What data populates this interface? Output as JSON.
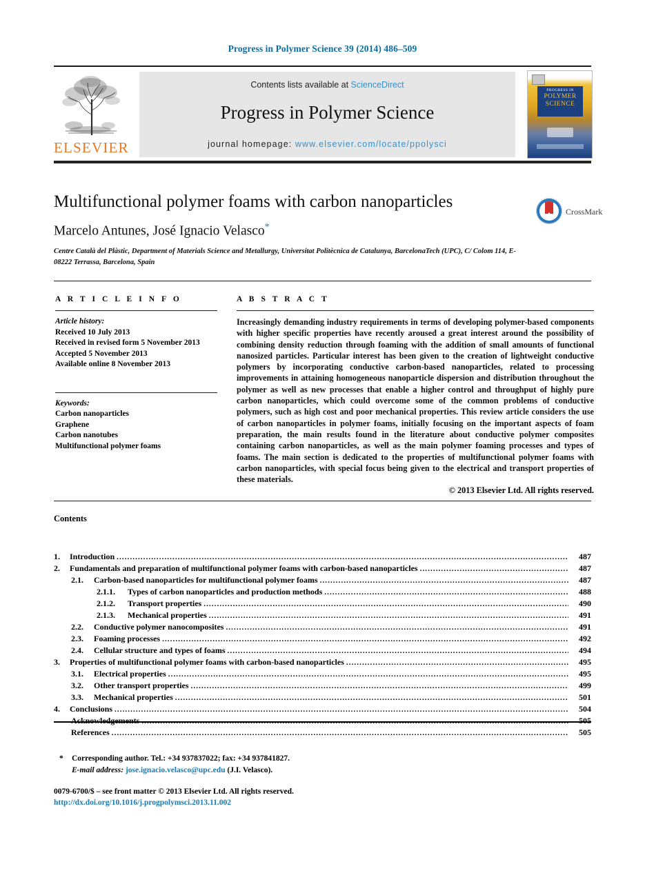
{
  "running_head": "Progress in Polymer Science 39 (2014) 486–509",
  "masthead": {
    "elsevier_wordmark": "ELSEVIER",
    "contents_prefix": "Contents lists available at ",
    "contents_link": "ScienceDirect",
    "journal_name": "Progress in Polymer Science",
    "homepage_prefix": "journal homepage: ",
    "homepage_url": "www.elsevier.com/locate/ppolysci",
    "cover": {
      "line1": "PROGRESS IN",
      "line2": "POLYMER",
      "line3": "SCIENCE"
    }
  },
  "article": {
    "title": "Multifunctional polymer foams with carbon nanoparticles",
    "authors": "Marcelo Antunes, José Ignacio Velasco",
    "corresponding_marker": "*",
    "affiliation": "Centre Català del Plàstic, Department of Materials Science and Metallurgy, Universitat Politècnica de Catalunya, BarcelonaTech (UPC), C/ Colom 114, E-08222 Terrassa, Barcelona, Spain",
    "crossmark_label": "CrossMark"
  },
  "article_info": {
    "heading": "A R T I C L E    I N F O",
    "history_label": "Article history:",
    "history": [
      "Received 10 July 2013",
      "Received in revised form 5 November 2013",
      "Accepted 5 November 2013",
      "Available online 8 November 2013"
    ],
    "keywords_label": "Keywords:",
    "keywords": [
      "Carbon nanoparticles",
      "Graphene",
      "Carbon nanotubes",
      "Multifunctional polymer foams"
    ]
  },
  "abstract": {
    "heading": "A B S T R A C T",
    "text": "Increasingly demanding industry requirements in terms of developing polymer-based components with higher specific properties have recently aroused a great interest around the possibility of combining density reduction through foaming with the addition of small amounts of functional nanosized particles. Particular interest has been given to the creation of lightweight conductive polymers by incorporating conductive carbon-based nanoparticles, related to processing improvements in attaining homogeneous nanoparticle dispersion and distribution throughout the polymer as well as new processes that enable a higher control and throughput of highly pure carbon nanoparticles, which could overcome some of the common problems of conductive polymers, such as high cost and poor mechanical properties. This review article considers the use of carbon nanoparticles in polymer foams, initially focusing on the important aspects of foam preparation, the main results found in the literature about conductive polymer composites containing carbon nanoparticles, as well as the main polymer foaming processes and types of foams. The main section is dedicated to the properties of multifunctional polymer foams with carbon nanoparticles, with special focus being given to the electrical and transport properties of these materials.",
    "copyright": "© 2013 Elsevier Ltd. All rights reserved."
  },
  "contents": {
    "heading": "Contents",
    "entries": [
      {
        "level": 1,
        "number": "1.",
        "label": "Introduction",
        "page": "487"
      },
      {
        "level": 1,
        "number": "2.",
        "label": "Fundamentals and preparation of multifunctional polymer foams with carbon-based nanoparticles",
        "page": "487"
      },
      {
        "level": 2,
        "number": "2.1.",
        "label": "Carbon-based nanoparticles for multifunctional polymer foams",
        "page": "487"
      },
      {
        "level": 3,
        "number": "2.1.1.",
        "label": "Types of carbon nanoparticles and production methods",
        "page": "488"
      },
      {
        "level": 3,
        "number": "2.1.2.",
        "label": "Transport properties",
        "page": "490"
      },
      {
        "level": 3,
        "number": "2.1.3.",
        "label": "Mechanical properties",
        "page": "491"
      },
      {
        "level": 2,
        "number": "2.2.",
        "label": "Conductive polymer nanocomposites",
        "page": "491"
      },
      {
        "level": 2,
        "number": "2.3.",
        "label": "Foaming processes",
        "page": "492"
      },
      {
        "level": 2,
        "number": "2.4.",
        "label": "Cellular structure and types of foams",
        "page": "494"
      },
      {
        "level": 1,
        "number": "3.",
        "label": "Properties of multifunctional polymer foams with carbon-based nanoparticles",
        "page": "495"
      },
      {
        "level": 2,
        "number": "3.1.",
        "label": "Electrical properties",
        "page": "495"
      },
      {
        "level": 2,
        "number": "3.2.",
        "label": "Other transport properties",
        "page": "499"
      },
      {
        "level": 2,
        "number": "3.3.",
        "label": "Mechanical properties",
        "page": "501"
      },
      {
        "level": 1,
        "number": "4.",
        "label": "Conclusions",
        "page": "504"
      },
      {
        "level": 0,
        "number": "",
        "label": "Acknowledgements",
        "page": "505"
      },
      {
        "level": 0,
        "number": "",
        "label": "References",
        "page": "505"
      }
    ]
  },
  "footnotes": {
    "corresponding_marker": "*",
    "corresponding_text": "Corresponding author. Tel.: +34 937837022; fax: +34 937841827.",
    "email_label": "E-mail address:",
    "email": "jose.ignacio.velasco@upc.edu",
    "email_suffix": "(J.I. Velasco).",
    "issn_line": "0079-6700/$ – see front matter © 2013 Elsevier Ltd. All rights reserved.",
    "doi": "http://dx.doi.org/10.1016/j.progpolymsci.2013.11.002"
  },
  "colors": {
    "link_blue": "#1a7bb0",
    "sciencedirect_blue": "#3a8fc4",
    "elsevier_orange": "#e87722",
    "cover_navy": "#1c3f7d",
    "cover_gold": "#f0c23a"
  }
}
